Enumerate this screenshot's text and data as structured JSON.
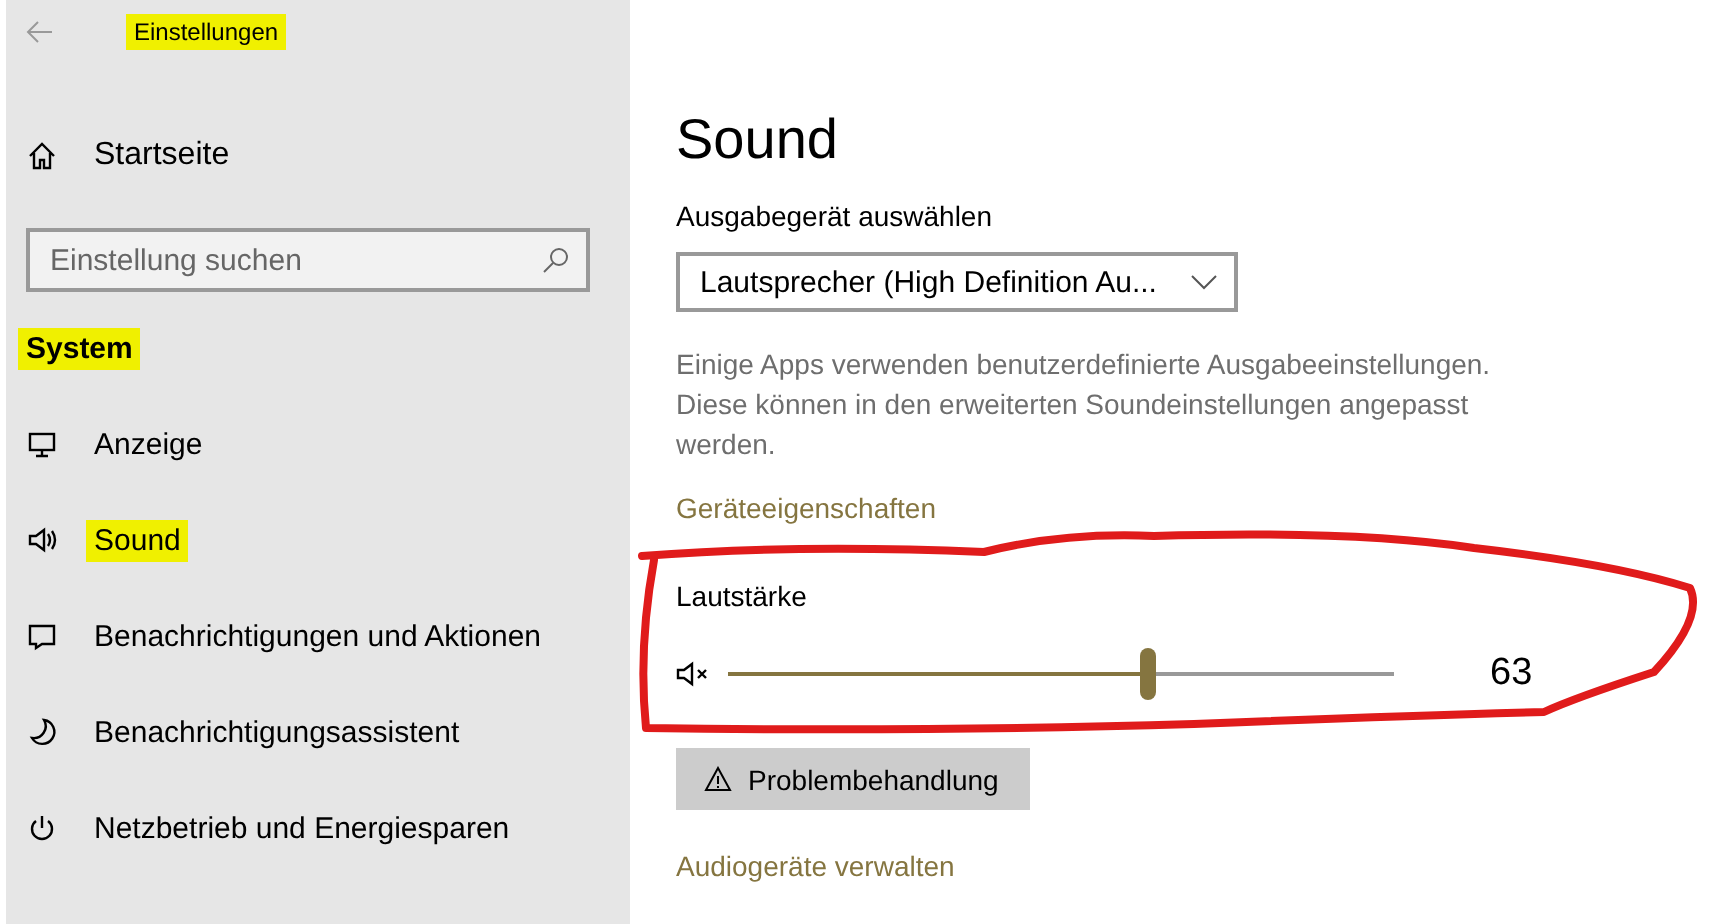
{
  "window": {
    "title": "Einstellungen",
    "title_highlighted": true
  },
  "sidebar": {
    "home": "Startseite",
    "search": {
      "placeholder": "Einstellung suchen"
    },
    "section": {
      "label": "System",
      "highlighted": true
    },
    "items": [
      {
        "label": "Anzeige",
        "highlighted": false
      },
      {
        "label": "Sound",
        "highlighted": true
      },
      {
        "label": "Benachrichtigungen und Aktionen",
        "highlighted": false
      },
      {
        "label": "Benachrichtigungsassistent",
        "highlighted": false
      },
      {
        "label": "Netzbetrieb und Energiesparen",
        "highlighted": false
      }
    ]
  },
  "content": {
    "title": "Sound",
    "output_label": "Ausgabegerät auswählen",
    "output_device": "Lautsprecher (High Definition Au...",
    "description": "Einige Apps verwenden benutzerdefinierte Ausgabeeinstellungen. Diese können in den erweiterten Soundeinstellungen angepasst werden.",
    "device_properties_link": "Geräteeigenschaften",
    "volume": {
      "label": "Lautstärke",
      "level": 0.63,
      "reading": "63",
      "muted": true
    },
    "troubleshoot_button": "Problembehandlung",
    "manage_link": "Audiogeräte verwalten"
  }
}
